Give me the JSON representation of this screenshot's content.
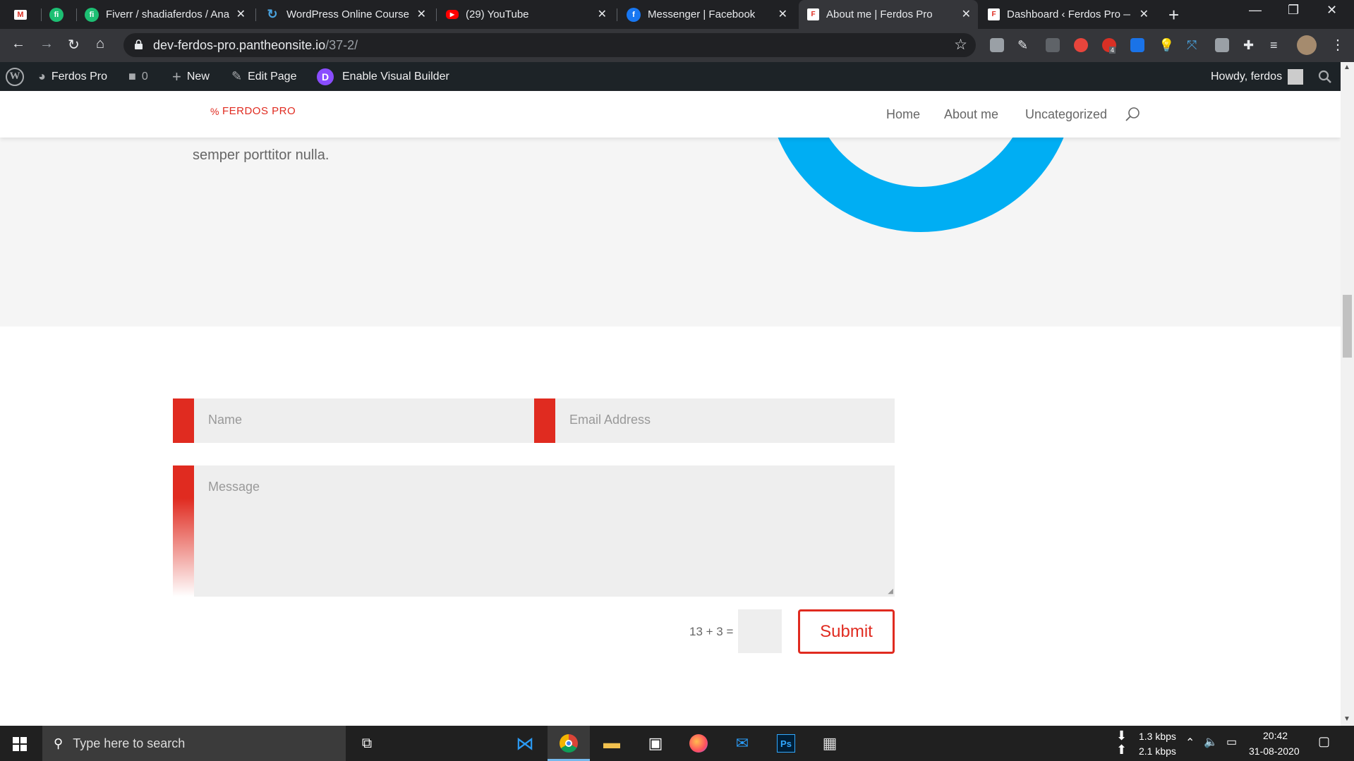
{
  "browser": {
    "tabs": [
      {
        "title": "",
        "icon": "gmail-icon",
        "color": "#d93025"
      },
      {
        "title": "",
        "icon": "fiverr-icon",
        "color": "#1dbf73"
      },
      {
        "title": "Fiverr / shadiaferdos / Ana",
        "icon": "fiverr-icon",
        "color": "#1dbf73"
      },
      {
        "title": "WordPress Online Course",
        "icon": "course-icon",
        "color": "#4aa3df"
      },
      {
        "title": "(29) YouTube",
        "icon": "youtube-icon",
        "color": "#ff0000"
      },
      {
        "title": "Messenger | Facebook",
        "icon": "facebook-icon",
        "color": "#1877f2"
      },
      {
        "title": "About me | Ferdos Pro",
        "icon": "wordpress-page-icon",
        "color": "#ffffff",
        "active": true
      },
      {
        "title": "Dashboard ‹ Ferdos Pro —",
        "icon": "wordpress-page-icon",
        "color": "#ffffff"
      }
    ],
    "url_host": "dev-ferdos-pro.pantheonsite.io",
    "url_path": "/37-2/",
    "ext_badge": "4"
  },
  "wp_admin": {
    "site_name": "Ferdos Pro",
    "comments_count": "0",
    "new_label": "New",
    "edit_label": "Edit Page",
    "visual_builder_label": "Enable Visual Builder",
    "divi_letter": "D",
    "howdy": "Howdy, ferdos"
  },
  "site": {
    "logo_text": "FERDOS PRO",
    "menu": [
      "Home",
      "About me",
      "Uncategorized"
    ],
    "body_text_partial": "semper porttitor nulla.",
    "accent_color": "#e02b20",
    "ring_color": "#00aef3"
  },
  "form": {
    "name_placeholder": "Name",
    "email_placeholder": "Email Address",
    "message_placeholder": "Message",
    "captcha": "13 + 3 =",
    "submit_label": "Submit"
  },
  "taskbar": {
    "search_placeholder": "Type here to search",
    "net_down": "1.3 kbps",
    "net_up": "2.1 kbps",
    "time": "20:42",
    "date": "31-08-2020"
  }
}
